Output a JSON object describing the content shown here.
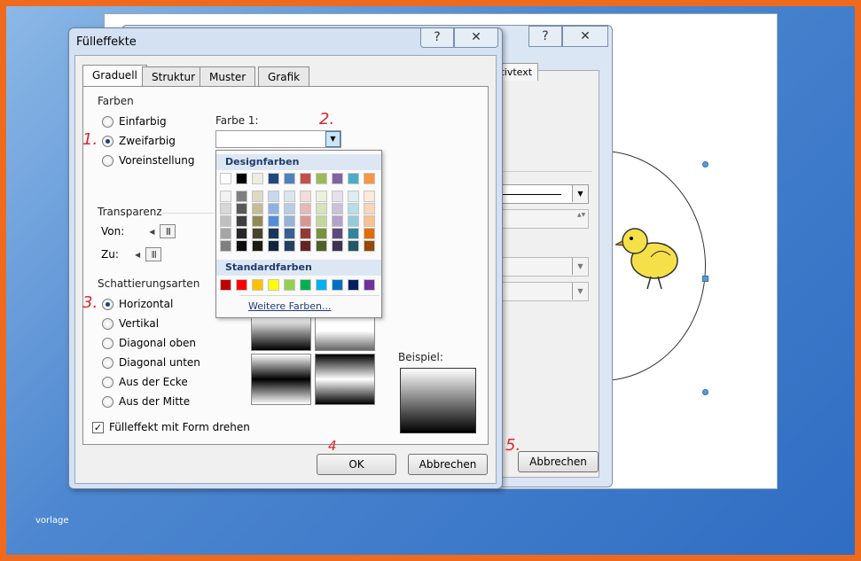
{
  "caption": "vorlage",
  "back_dialog": {
    "tab_label": "mativtext",
    "cancel_label": "Abbrechen",
    "help_glyph": "?",
    "close_glyph": "✕"
  },
  "dialog": {
    "title": "Fülleffekte",
    "help_glyph": "?",
    "close_glyph": "✕",
    "tabs": [
      {
        "label": "Graduell"
      },
      {
        "label": "Struktur"
      },
      {
        "label": "Muster"
      },
      {
        "label": "Grafik"
      }
    ],
    "farben": {
      "group_label": "Farben",
      "options": [
        {
          "label": "Einfarbig",
          "selected": false
        },
        {
          "label": "Zweifarbig",
          "selected": true
        },
        {
          "label": "Voreinstellung",
          "selected": false
        }
      ],
      "color1_label": "Farbe 1:"
    },
    "transparenz": {
      "group_label": "Transparenz",
      "from_label": "Von:",
      "to_label": "Zu:"
    },
    "schattierung": {
      "group_label": "Schattierungsarten",
      "options": [
        {
          "label": "Horizontal",
          "selected": true
        },
        {
          "label": "Vertikal",
          "selected": false
        },
        {
          "label": "Diagonal oben",
          "selected": false
        },
        {
          "label": "Diagonal unten",
          "selected": false
        },
        {
          "label": "Aus der Ecke",
          "selected": false
        },
        {
          "label": "Aus der Mitte",
          "selected": false
        }
      ]
    },
    "beispiel_label": "Beispiel:",
    "rotate_checkbox": {
      "label": "Fülleffekt mit Form drehen",
      "checked": true,
      "glyph": "✓"
    },
    "ok_label": "OK",
    "cancel_label": "Abbrechen"
  },
  "color_popup": {
    "design_header": "Designfarben",
    "standard_header": "Standardfarben",
    "more_colors": "Weitere Farben...",
    "theme_top": [
      "#ffffff",
      "#000000",
      "#eeece1",
      "#1f497d",
      "#4f81bd",
      "#c0504d",
      "#9bbb59",
      "#8064a2",
      "#4bacc6",
      "#f79646"
    ],
    "theme_shades": [
      [
        "#f2f2f2",
        "#7f7f7f",
        "#ddd9c3",
        "#c6d9f0",
        "#dbe5f1",
        "#f2dcdb",
        "#ebf1dd",
        "#e5e0ec",
        "#dbeef3",
        "#fdeada"
      ],
      [
        "#d8d8d8",
        "#595959",
        "#c4bd97",
        "#8db3e2",
        "#b8cce4",
        "#e5b9b7",
        "#d7e3bc",
        "#ccc1d9",
        "#b7dde8",
        "#fbd5b5"
      ],
      [
        "#bfbfbf",
        "#3f3f3f",
        "#938953",
        "#548dd4",
        "#95b3d7",
        "#d99694",
        "#c3d69b",
        "#b2a2c7",
        "#92cddc",
        "#fac08f"
      ],
      [
        "#a5a5a5",
        "#262626",
        "#494429",
        "#17365d",
        "#366092",
        "#953734",
        "#76923c",
        "#5f497a",
        "#31859b",
        "#e36c09"
      ],
      [
        "#7f7f7f",
        "#0c0c0c",
        "#1d1b10",
        "#0f243e",
        "#244061",
        "#632423",
        "#4f6128",
        "#3f3151",
        "#205867",
        "#974806"
      ]
    ],
    "standard": [
      "#c00000",
      "#ff0000",
      "#ffc000",
      "#ffff00",
      "#92d050",
      "#00b050",
      "#00b0f0",
      "#0070c0",
      "#002060",
      "#7030a0"
    ]
  },
  "annotations": [
    "1.",
    "2.",
    "3.",
    "4",
    "5."
  ],
  "arrow_glyph": "▼",
  "slider_arrow": "◀",
  "slider_thumb": "|||",
  "spin_glyph": "▲▼"
}
